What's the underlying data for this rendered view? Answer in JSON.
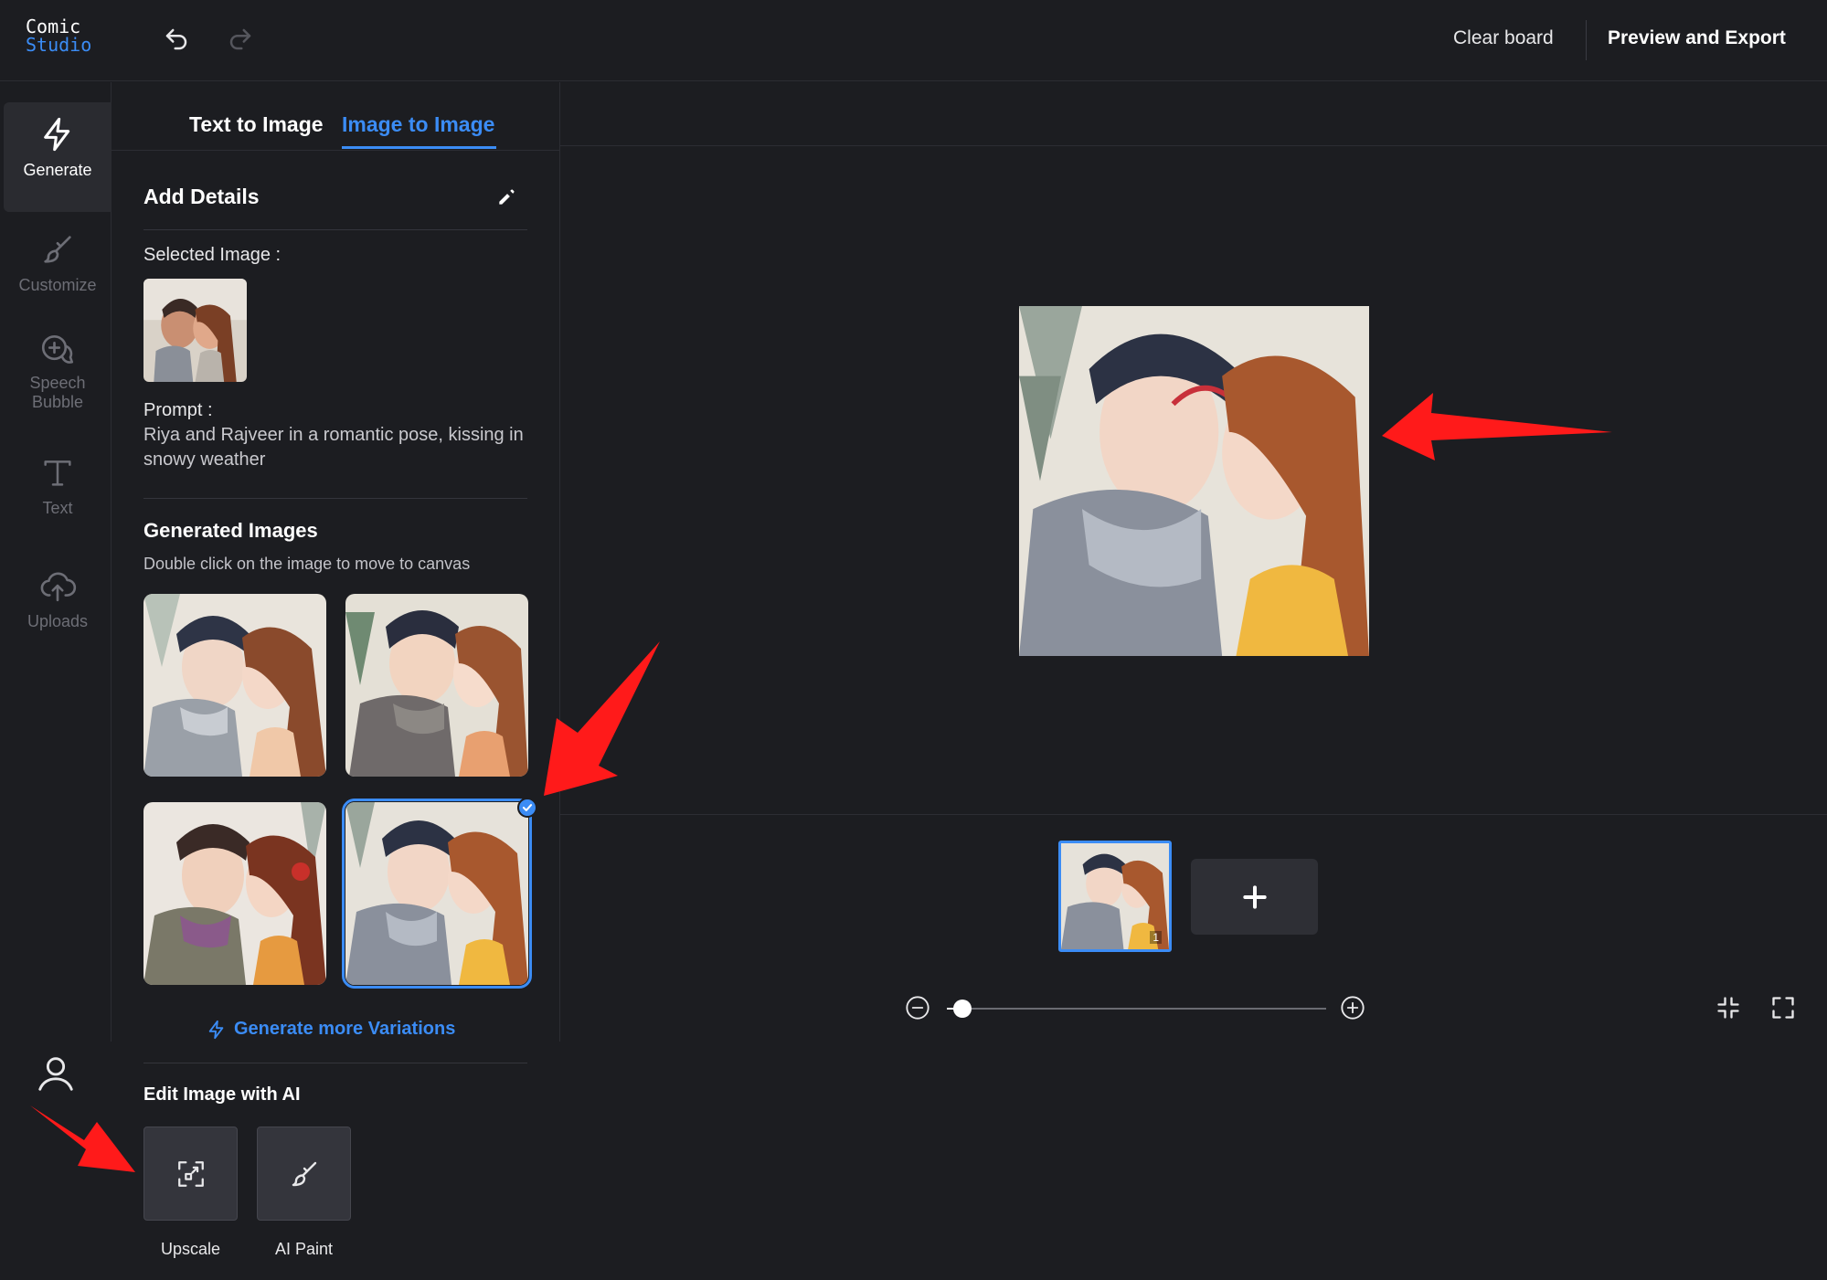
{
  "header": {
    "logo_line1": "Comic",
    "logo_line2": "Studio",
    "clear_board": "Clear board",
    "preview_export": "Preview and Export"
  },
  "sidebar": {
    "items": [
      {
        "label": "Generate",
        "icon": "lightning-icon"
      },
      {
        "label": "Customize",
        "icon": "brush-icon"
      },
      {
        "label": "Speech\nBubble",
        "icon": "speech-bubble-icon"
      },
      {
        "label": "Text",
        "icon": "text-icon"
      },
      {
        "label": "Uploads",
        "icon": "upload-cloud-icon"
      }
    ],
    "account_icon": "user-icon"
  },
  "panel": {
    "tabs": [
      "Text to Image",
      "Image to Image"
    ],
    "active_tab": "Image to Image",
    "add_details": "Add Details",
    "selected_image_label": "Selected Image :",
    "prompt_label": "Prompt :",
    "prompt_text": "Riya and Rajveer in a romantic pose, kissing in snowy weather",
    "generated_title": "Generated Images",
    "generated_subtitle": "Double click on the image to move to canvas",
    "generated_count": 4,
    "selected_index": 3,
    "more_variations": "Generate more Variations",
    "edit_title": "Edit Image with AI",
    "tools": [
      {
        "label": "Upscale",
        "icon": "upscale-icon"
      },
      {
        "label": "AI Paint",
        "icon": "paint-brush-icon"
      }
    ]
  },
  "canvas": {
    "page_number": "1",
    "zoom_fraction": 0.04
  },
  "colors": {
    "background": "#1c1d21",
    "accent": "#3b8cf5",
    "annotation": "#ff1a1a"
  }
}
